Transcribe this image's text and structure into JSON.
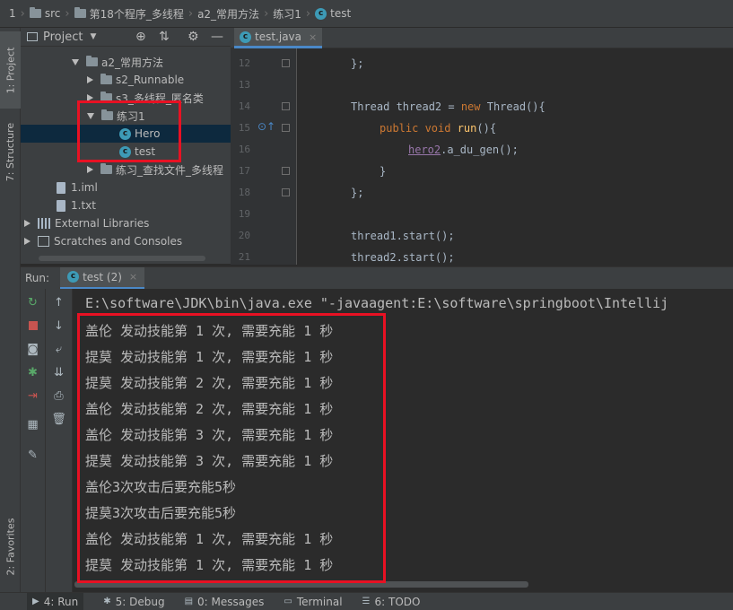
{
  "breadcrumb": [
    "1",
    "src",
    "第18个程序_多线程",
    "a2_常用方法",
    "练习1",
    "test"
  ],
  "left_tabs": {
    "project": "1: Project",
    "structure": "7: Structure",
    "favorites": "2: Favorites"
  },
  "project_panel": {
    "title": "Project",
    "tree": [
      {
        "label": "a2_常用方法"
      },
      {
        "label": "s2_Runnable"
      },
      {
        "label": "s3_多线程_匿名类"
      },
      {
        "label": "练习1"
      },
      {
        "label": "Hero"
      },
      {
        "label": "test"
      },
      {
        "label": "练习_查找文件_多线程"
      },
      {
        "label": "1.iml"
      },
      {
        "label": "1.txt"
      },
      {
        "label": "External Libraries"
      },
      {
        "label": "Scratches and Consoles"
      }
    ]
  },
  "editor": {
    "tab": "test.java",
    "line_numbers": [
      "12",
      "13",
      "14",
      "15",
      "16",
      "17",
      "18",
      "19",
      "20",
      "21"
    ],
    "code": {
      "l12": "};",
      "l14_a": "Thread thread2 = ",
      "l14_b": "new ",
      "l14_c": "Thread(){",
      "l15_a": "public void ",
      "l15_b": "run",
      "l15_c": "(){",
      "l16_a": "hero2",
      "l16_b": ".a_du_gen();",
      "l17": "}",
      "l18": "};",
      "l20": "thread1.start();",
      "l21": "thread2.start();"
    }
  },
  "run_panel": {
    "label": "Run:",
    "tab": "test (2)",
    "command": "E:\\software\\JDK\\bin\\java.exe \"-javaagent:E:\\software\\springboot\\Intellij",
    "output": [
      "盖伦 发动技能第 1 次, 需要充能 1 秒",
      "提莫 发动技能第 1 次, 需要充能 1 秒",
      "提莫 发动技能第 2 次, 需要充能 1 秒",
      "盖伦 发动技能第 2 次, 需要充能 1 秒",
      "盖伦 发动技能第 3 次, 需要充能 1 秒",
      "提莫 发动技能第 3 次, 需要充能 1 秒",
      "盖伦3次攻击后要充能5秒",
      "提莫3次攻击后要充能5秒",
      "盖伦 发动技能第 1 次, 需要充能 1 秒",
      "提莫 发动技能第 1 次, 需要充能 1 秒"
    ]
  },
  "bottom_tabs": [
    {
      "label": "4: Run",
      "icon": "play-icon"
    },
    {
      "label": "5: Debug",
      "icon": "bug-icon"
    },
    {
      "label": "0: Messages",
      "icon": "messages-icon"
    },
    {
      "label": "Terminal",
      "icon": "terminal-icon"
    },
    {
      "label": "6: TODO",
      "icon": "todo-icon"
    }
  ],
  "colors": {
    "highlight_box": "#e81123",
    "selection": "#0d293e",
    "accent": "#4a88c7"
  }
}
